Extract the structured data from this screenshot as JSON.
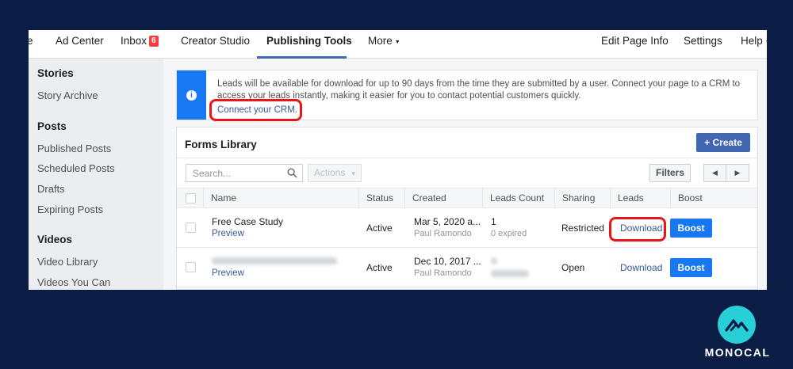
{
  "nav": {
    "items": [
      "e",
      "Ad Center",
      "Inbox",
      "Creator Studio",
      "Publishing Tools",
      "More",
      "Edit Page Info",
      "Settings",
      "Help"
    ],
    "inbox_badge": "6",
    "accent": "#4267b2"
  },
  "sidebar": {
    "sections": [
      {
        "header": "Stories",
        "items": [
          "Story Archive"
        ]
      },
      {
        "header": "Posts",
        "items": [
          "Published Posts",
          "Scheduled Posts",
          "Drafts",
          "Expiring Posts"
        ]
      },
      {
        "header": "Videos",
        "items": [
          "Video Library",
          "Videos You Can"
        ]
      }
    ]
  },
  "banner": {
    "message": "Leads will be available for download for up to 90 days from the time they are submitted by a user. Connect your page to a CRM to access your leads instantly, making it easier for you to contact potential customers quickly.",
    "link": "Connect your CRM.",
    "icon": "info-icon"
  },
  "forms": {
    "title": "Forms Library",
    "create_label": "+ Create",
    "search_placeholder": "Search...",
    "actions_label": "Actions",
    "filters_label": "Filters",
    "columns": [
      "Name",
      "Status",
      "Created",
      "Leads Count",
      "Sharing",
      "Leads",
      "Boost"
    ],
    "rows": [
      {
        "name": "Free Case Study",
        "preview": "Preview",
        "status": "Active",
        "created": "Mar 5, 2020 a...",
        "creator": "Paul Ramondo",
        "leads_count": "1",
        "expired": "0 expired",
        "sharing": "Restricted",
        "leads": "Download",
        "boost": "Boost"
      },
      {
        "name": "",
        "preview": "Preview",
        "status": "Active",
        "created": "Dec 10, 2017 ...",
        "creator": "Paul Ramondo",
        "leads_count": "",
        "expired": "",
        "sharing": "Open",
        "leads": "Download",
        "boost": "Boost"
      }
    ]
  },
  "brand": {
    "name": "MONOCAL",
    "color": "#28cfd6"
  },
  "colors": {
    "background": "#0b1d45",
    "highlight": "#e8161c",
    "primary": "#1877f2"
  }
}
